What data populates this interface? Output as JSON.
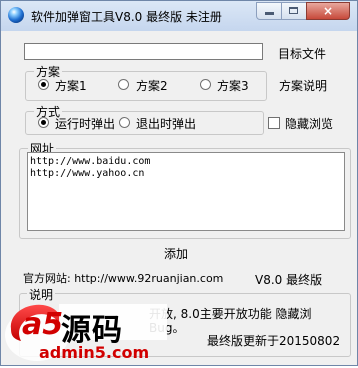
{
  "window": {
    "title": "软件加弹窗工具V8.0 最终版   未注册",
    "close_label": "×",
    "accent": "#c7493a"
  },
  "target": {
    "label": "目标文件",
    "value": ""
  },
  "scheme": {
    "legend": "方案",
    "options": [
      "方案1",
      "方案2",
      "方案3"
    ],
    "selected": "方案1",
    "help_label": "方案说明"
  },
  "mode": {
    "legend": "方式",
    "options": [
      "运行时弹出",
      "退出时弹出"
    ],
    "selected": "运行时弹出"
  },
  "hide_browse": {
    "label": "隐藏浏览",
    "checked": false
  },
  "urls": {
    "legend": "网址",
    "lines": [
      "http://www.baidu.com",
      "http://www.yahoo.cn"
    ]
  },
  "add_button": "添加",
  "footer": {
    "site": "官方网站: http://www.92ruanjian.com",
    "version": "V8.0 最终版"
  },
  "note": {
    "legend": "说明",
    "line1": "开放, 8.0主要开放功能 隐藏浏",
    "line2": "Bug。",
    "updated": "最终版更新于20150802"
  },
  "watermark": {
    "text": "源码",
    "domain": "admin5.com",
    "badge": "a5"
  }
}
